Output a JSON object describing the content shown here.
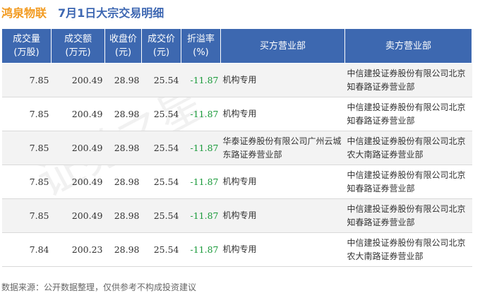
{
  "header": {
    "stock_name": "鸿泉物联",
    "title": "7月1日大宗交易明细"
  },
  "watermark": "证券之星",
  "table": {
    "columns": [
      "成交量(万股)",
      "成交额(万元)",
      "收盘价(元)",
      "成交价(元)",
      "折溢率(%)",
      "买方营业部",
      "卖方营业部"
    ],
    "column_lines": [
      [
        "成交量",
        "(万股)"
      ],
      [
        "成交额",
        "(万元)"
      ],
      [
        "收盘价",
        "(元)"
      ],
      [
        "成交价",
        "(元)"
      ],
      [
        "折溢率",
        "(%)"
      ],
      [
        "买方营业部"
      ],
      [
        "卖方营业部"
      ]
    ],
    "rows": [
      {
        "volume": "7.85",
        "amount": "200.49",
        "close": "28.98",
        "price": "25.54",
        "premium": "-11.87",
        "buyer": "机构专用",
        "seller": "中信建投证券股份有限公司北京知春路证券营业部"
      },
      {
        "volume": "7.85",
        "amount": "200.49",
        "close": "28.98",
        "price": "25.54",
        "premium": "-11.87",
        "buyer": "机构专用",
        "seller": "中信建投证券股份有限公司北京知春路证券营业部"
      },
      {
        "volume": "7.85",
        "amount": "200.49",
        "close": "28.98",
        "price": "25.54",
        "premium": "-11.87",
        "buyer": "华泰证券股份有限公司广州云城东路证券营业部",
        "seller": "中信建投证券股份有限公司北京农大南路证券营业部"
      },
      {
        "volume": "7.85",
        "amount": "200.49",
        "close": "28.98",
        "price": "25.54",
        "premium": "-11.87",
        "buyer": "机构专用",
        "seller": "中信建投证券股份有限公司北京知春路证券营业部"
      },
      {
        "volume": "7.85",
        "amount": "200.49",
        "close": "28.98",
        "price": "25.54",
        "premium": "-11.87",
        "buyer": "机构专用",
        "seller": "中信建投证券股份有限公司北京知春路证券营业部"
      },
      {
        "volume": "7.84",
        "amount": "200.23",
        "close": "28.98",
        "price": "25.54",
        "premium": "-11.87",
        "buyer": "机构专用",
        "seller": "中信建投证券股份有限公司北京农大南路证券营业部"
      }
    ]
  },
  "footer": "数据来源：公开数据整理，仅供参考不构成投资建议",
  "colors": {
    "stock_name": "#f29a1f",
    "title": "#3d67b2",
    "header_bg": "#3d68b0",
    "negative": "#1a9a3a"
  }
}
